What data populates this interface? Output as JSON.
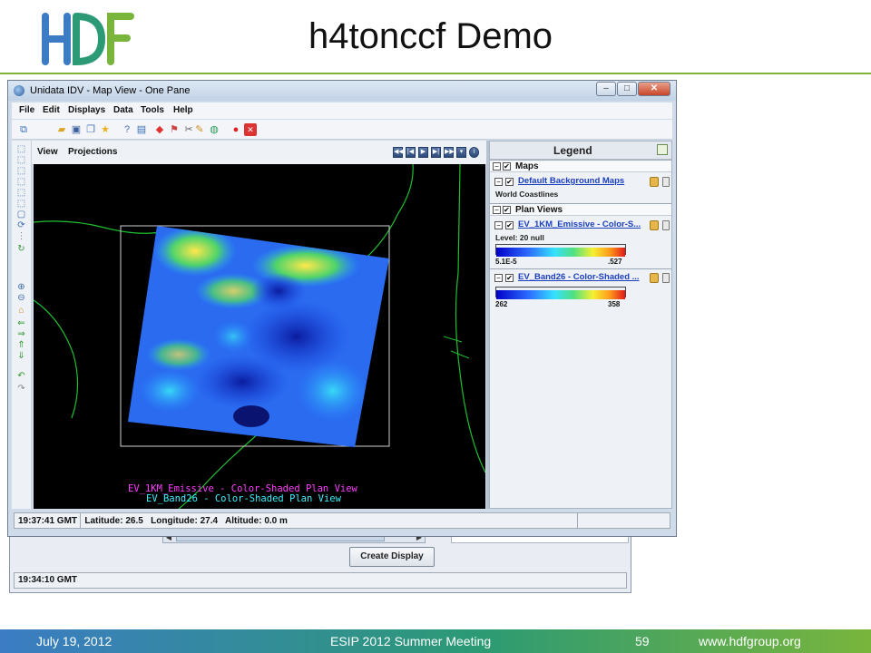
{
  "slide": {
    "title": "h4tonccf Demo",
    "logo_text": "HDF",
    "colors": {
      "accent_green": "#7fb23a",
      "accent_blue": "#3b7cc4"
    }
  },
  "back_window": {
    "create_button": "Create Display",
    "status_time": "19:34:10 GMT"
  },
  "window": {
    "title": "Unidata IDV - Map View - One Pane",
    "controls": [
      "minimize-icon",
      "maximize-icon",
      "close-icon"
    ],
    "menu": [
      "File",
      "Edit",
      "Displays",
      "Data",
      "Tools",
      "Help"
    ],
    "toolbar_icons": [
      "dashboard-icon",
      "open-folder-icon",
      "save-icon",
      "copy-icon",
      "star-icon",
      "help-icon",
      "dataset-icon",
      "erase-icon",
      "flag-icon",
      "cut-icon",
      "pencil-icon",
      "globe-icon",
      "stop-icon",
      "close-icon"
    ],
    "view_menu": [
      "View",
      "Projections"
    ],
    "animation_icons": [
      "rewind-icon",
      "step-back-icon",
      "play-icon",
      "step-forward-icon",
      "fast-forward-icon",
      "animation-menu-icon",
      "info-icon"
    ],
    "map_overlay": {
      "label_1": "EV_1KM_Emissive - Color-Shaded Plan View",
      "label_2": "EV_Band26 - Color-Shaded Plan View",
      "label_1_color": "#ff3cff",
      "label_2_color": "#3cf0ff"
    },
    "legend": {
      "title": "Legend",
      "maps_section": "Maps",
      "maps_entry": "Default Background Maps",
      "maps_sub": "World Coastlines",
      "plan_section": "Plan Views",
      "entry_1": "EV_1KM_Emissive - Color-S...",
      "entry_1_level": "Level: 20 null",
      "entry_1_min": "5.1E-5",
      "entry_1_max": ".527",
      "entry_2": "EV_Band26 - Color-Shaded ...",
      "entry_2_min": "262",
      "entry_2_max": "358"
    },
    "status": "19:37:41 GMT   Latitude: 26.5   Longitude: 27.4   Altitude: 0.0 m"
  },
  "footer": {
    "date": "July 19, 2012",
    "event": "ESIP 2012 Summer Meeting",
    "page": "59",
    "url": "www.hdfgroup.org"
  }
}
